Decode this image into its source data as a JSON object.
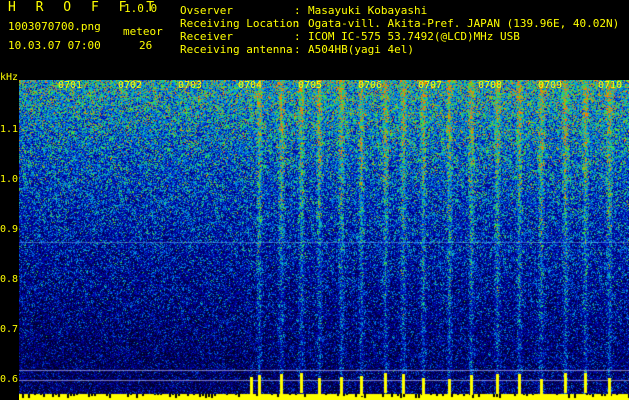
{
  "header": {
    "app_name": "H R O F F T",
    "version": "1.0.0",
    "file_name": "1003070700.png",
    "datetime": "10.03.07 07:00",
    "meteor_label": "meteor",
    "meteor_count": "26"
  },
  "info": [
    {
      "key": "Ovserver",
      "value": "Masayuki Kobayashi"
    },
    {
      "key": "Receiving Location",
      "value": "Ogata-vill. Akita-Pref. JAPAN (139.96E, 40.02N)"
    },
    {
      "key": "Receiver",
      "value": "ICOM IC-575 53.7492(@LCD)MHz USB"
    },
    {
      "key": "Receiving antenna",
      "value": "A504HB(yagi 4el)"
    }
  ],
  "separator": ":",
  "waterfall": {
    "unit_label": "kHz",
    "y_ticks": [
      "1.1",
      "1.0",
      "0.9",
      "0.8",
      "0.7",
      "0.6"
    ],
    "x_ticks": [
      "0701",
      "0702",
      "0703",
      "0704",
      "0705",
      "0706",
      "0707",
      "0708",
      "0709",
      "0710"
    ],
    "colors": {
      "text": "#ffff00",
      "background": "#000000",
      "baseline": "#ffff00"
    }
  }
}
